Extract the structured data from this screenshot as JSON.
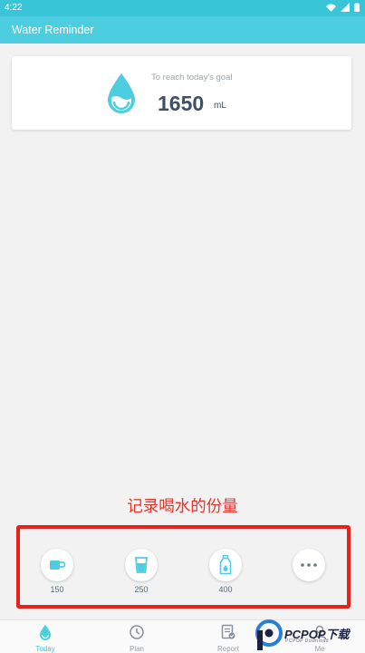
{
  "status_bar": {
    "time": "4:22",
    "icons": [
      "wifi-icon",
      "cellular-icon",
      "battery-icon"
    ]
  },
  "app_bar": {
    "title": "Water Reminder"
  },
  "goal": {
    "caption": "To reach today's goal",
    "value": "1650",
    "unit": "mL",
    "icon": "water-drop-icon"
  },
  "annotation": {
    "text": "记录喝水的份量"
  },
  "cups": [
    {
      "label": "150",
      "icon": "mug-icon"
    },
    {
      "label": "250",
      "icon": "glass-icon"
    },
    {
      "label": "400",
      "icon": "bottle-icon"
    },
    {
      "label": "",
      "icon": "more-icon"
    }
  ],
  "nav": [
    {
      "label": "Today",
      "icon": "water-drop-icon",
      "active": true
    },
    {
      "label": "Plan",
      "icon": "clock-icon",
      "active": false
    },
    {
      "label": "Report",
      "icon": "report-icon",
      "active": false
    },
    {
      "label": "Me",
      "icon": "person-icon",
      "active": false
    }
  ],
  "watermark": {
    "brand": "PCPOP下载",
    "sub": "PCPOP Download"
  },
  "colors": {
    "accent": "#4dcde0",
    "status_bar": "#38c5d8",
    "highlight": "#e8221a",
    "goal_text": "#3d5068"
  }
}
